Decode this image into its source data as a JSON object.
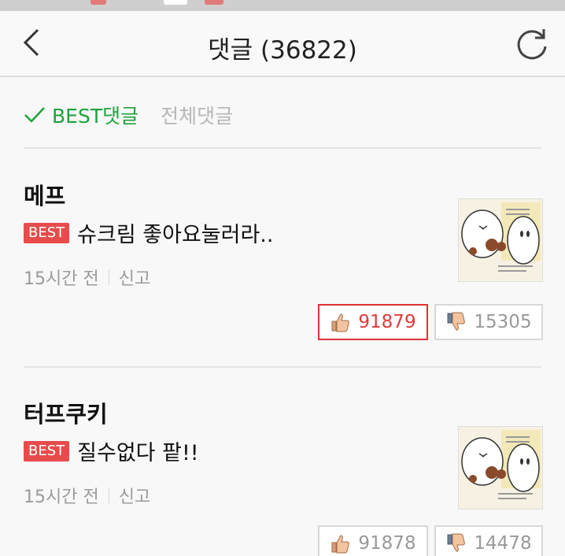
{
  "header": {
    "title": "댓글 (36822)"
  },
  "tabs": {
    "best_label": "BEST댓글",
    "all_label": "전체댓글"
  },
  "comments": [
    {
      "author": "메프",
      "badge": "BEST",
      "text": "슈크림 좋아요눌러라..",
      "time": "15시간 전",
      "report": "신고",
      "likes": "91879",
      "dislikes": "15305"
    },
    {
      "author": "터프쿠키",
      "badge": "BEST",
      "text": "질수없다 팥!!",
      "time": "15시간 전",
      "report": "신고",
      "likes": "91878",
      "dislikes": "14478"
    }
  ],
  "colors": {
    "accent_green": "#1ea23c",
    "best_badge": "#e84b4b",
    "like_red": "#e23b3b"
  }
}
